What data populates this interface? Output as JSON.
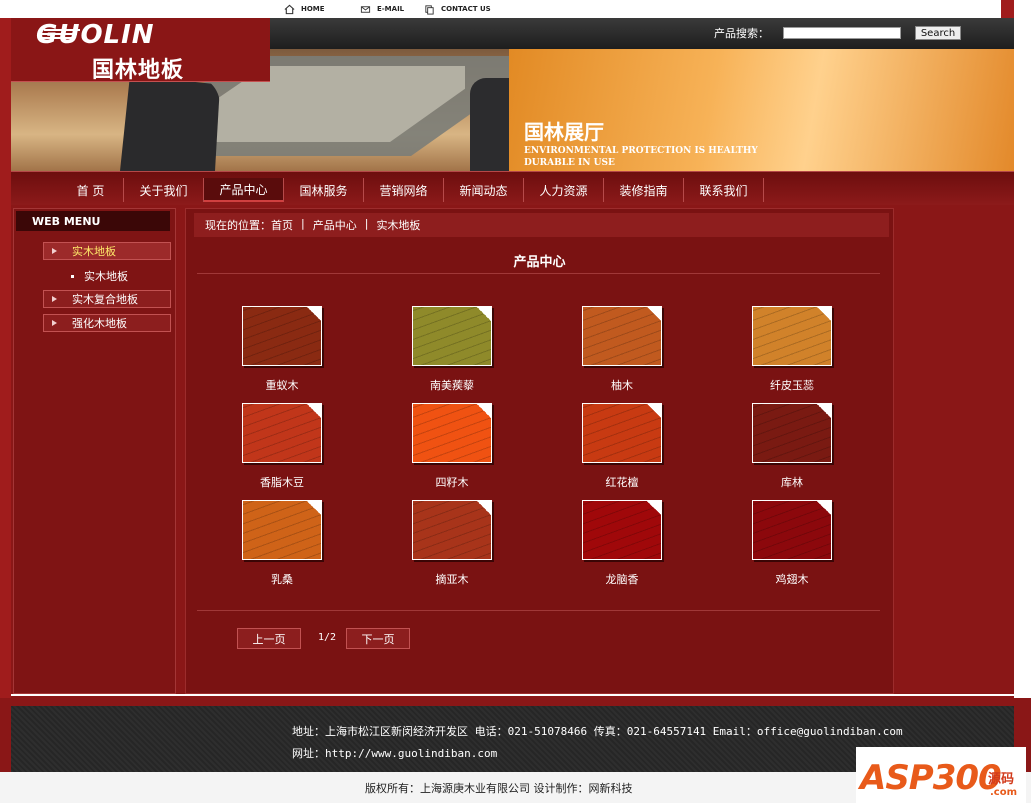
{
  "topbar": {
    "home_label": "HOME",
    "email_label": "E-MAIL",
    "contact_label": "CONTACT US"
  },
  "header": {
    "logo_en": "GUOLIN",
    "logo_cn": "国林地板",
    "search_label": "产品搜索：",
    "search_value": "",
    "search_button": "Search",
    "showroom_title": "国林展厅",
    "showroom_line1": "ENVIRONMENTAL PROTECTION IS HEALTHY",
    "showroom_line2": "DURABLE IN USE"
  },
  "nav": {
    "items": [
      {
        "label": "首  页"
      },
      {
        "label": "关于我们"
      },
      {
        "label": "产品中心"
      },
      {
        "label": "国林服务"
      },
      {
        "label": "营销网络"
      },
      {
        "label": "新闻动态"
      },
      {
        "label": "人力资源"
      },
      {
        "label": "装修指南"
      },
      {
        "label": "联系我们"
      }
    ],
    "active_index": 2
  },
  "sidebar": {
    "title": "WEB MENU",
    "items": [
      {
        "label": "实木地板"
      },
      {
        "label": "实木复合地板"
      },
      {
        "label": "强化木地板"
      }
    ],
    "sub_item": "实木地板"
  },
  "main": {
    "breadcrumb": {
      "prefix": "现在的位置：",
      "home": "首页",
      "sep1": "|",
      "section": "产品中心",
      "sep2": "|",
      "current": "实木地板"
    },
    "title": "产品中心",
    "products": [
      {
        "name": "重蚁木",
        "color": "#8a2a12"
      },
      {
        "name": "南美蒺藜",
        "color": "#8f8a2a"
      },
      {
        "name": "柚木",
        "color": "#c15a1f"
      },
      {
        "name": "纤皮玉蕊",
        "color": "#d1822a"
      },
      {
        "name": "香脂木豆",
        "color": "#c1361a"
      },
      {
        "name": "四籽木",
        "color": "#f05212"
      },
      {
        "name": "红花檀",
        "color": "#c83a12"
      },
      {
        "name": "库林",
        "color": "#7a1a12"
      },
      {
        "name": "乳桑",
        "color": "#cf6318"
      },
      {
        "name": "摘亚木",
        "color": "#a8341a"
      },
      {
        "name": "龙脑香",
        "color": "#a0080a"
      },
      {
        "name": "鸡翅木",
        "color": "#8c080c"
      }
    ],
    "pager": {
      "prev": "上一页",
      "page": "1/2",
      "next": "下一页"
    }
  },
  "footer": {
    "address_line": "地址：上海市松江区新闵经济开发区 电话：021-51078466 传真：021-64557141 Email：office@guolindiban.com",
    "web_line": "网址：http://www.guolindiban.com",
    "copyright": "版权所有：上海源庚木业有限公司 设计制作：网新科技"
  },
  "watermark": {
    "text": "ASP300",
    "cn": "源码",
    "com": ".com"
  }
}
